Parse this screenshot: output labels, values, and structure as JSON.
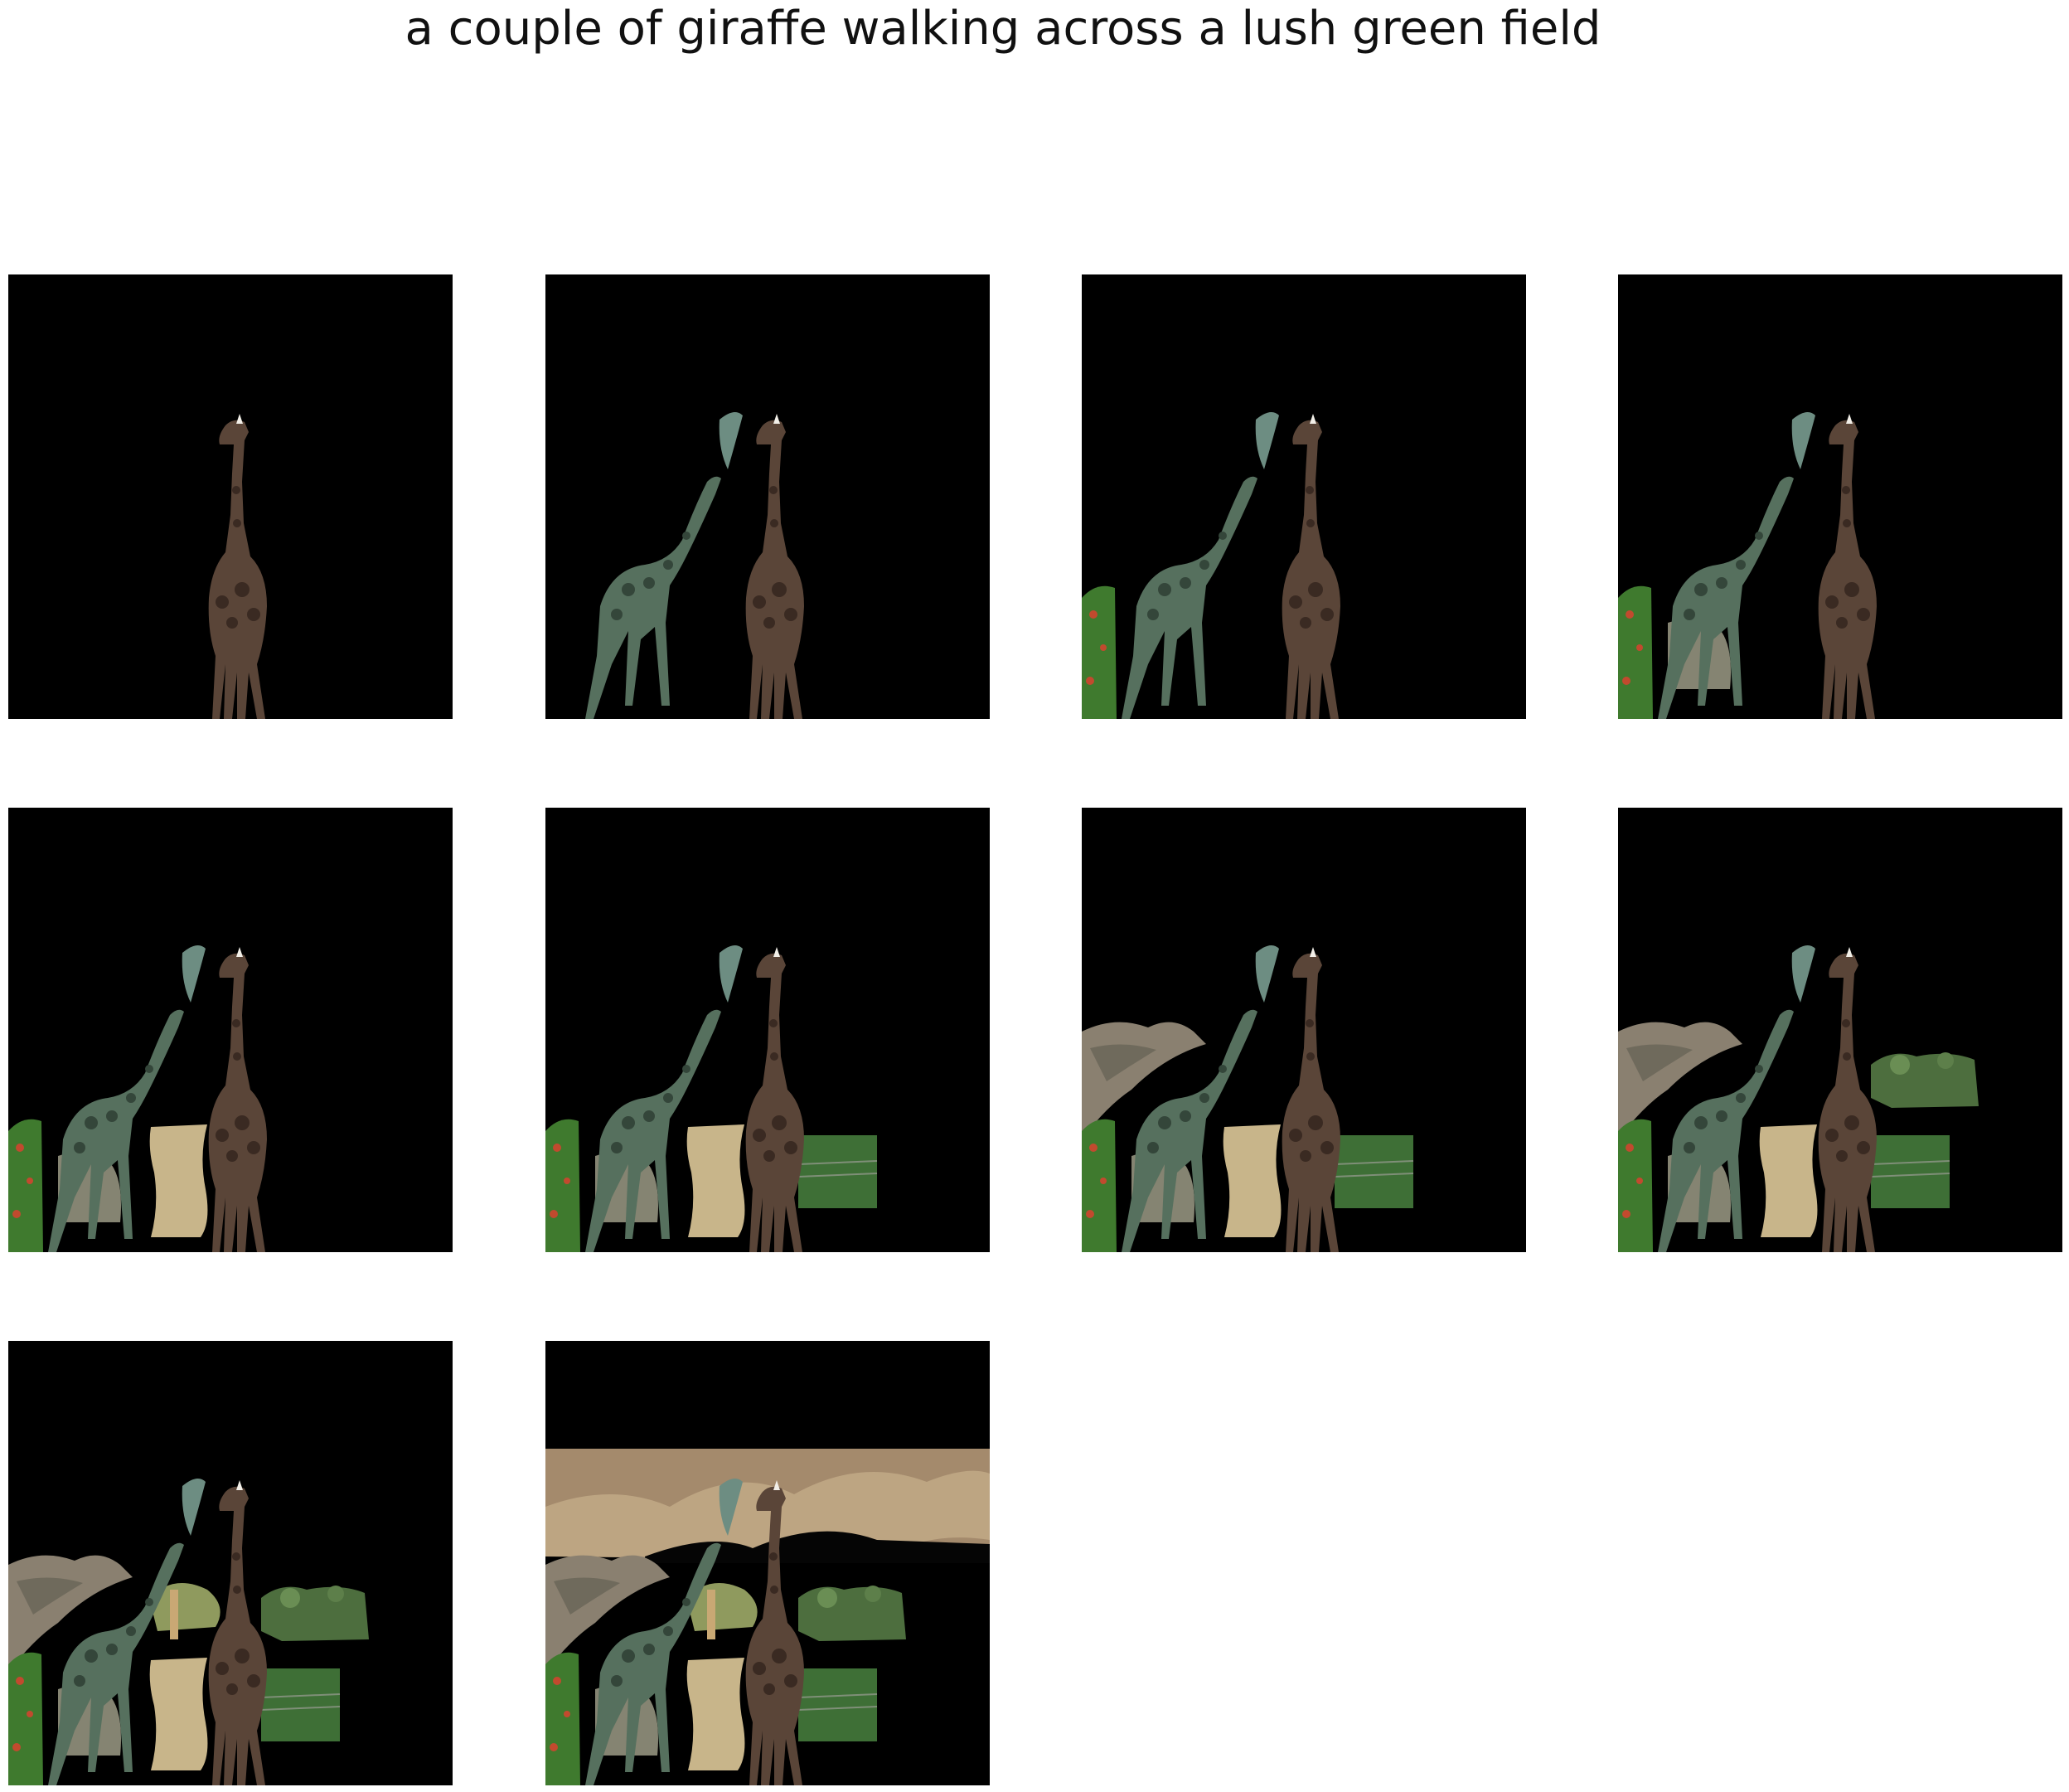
{
  "caption": "a couple of giraffe walking across a lush green field",
  "panels": [
    {
      "step": 1,
      "layers": [
        "giraffe-a"
      ]
    },
    {
      "step": 2,
      "layers": [
        "giraffe-a",
        "giraffe-b",
        "head-patch"
      ]
    },
    {
      "step": 3,
      "layers": [
        "giraffe-a",
        "giraffe-b",
        "head-patch",
        "bush-left"
      ]
    },
    {
      "step": 4,
      "layers": [
        "giraffe-a",
        "giraffe-b",
        "head-patch",
        "bush-left",
        "ground-patch"
      ]
    },
    {
      "step": 5,
      "layers": [
        "giraffe-a",
        "giraffe-b",
        "head-patch",
        "bush-left",
        "ground-patch",
        "sand-patch"
      ]
    },
    {
      "step": 6,
      "layers": [
        "giraffe-a",
        "giraffe-b",
        "head-patch",
        "bush-left",
        "ground-patch",
        "sand-patch",
        "grass-patch"
      ]
    },
    {
      "step": 7,
      "layers": [
        "giraffe-a",
        "giraffe-b",
        "head-patch",
        "bush-left",
        "ground-patch",
        "sand-patch",
        "grass-patch",
        "rocks-left"
      ]
    },
    {
      "step": 8,
      "layers": [
        "giraffe-a",
        "giraffe-b",
        "head-patch",
        "bush-left",
        "ground-patch",
        "sand-patch",
        "grass-patch",
        "rocks-left",
        "trees-right"
      ]
    },
    {
      "step": 9,
      "layers": [
        "giraffe-a",
        "giraffe-b",
        "head-patch",
        "bush-left",
        "ground-patch",
        "sand-patch",
        "grass-patch",
        "rocks-left",
        "trees-right",
        "shrub-center"
      ]
    },
    {
      "step": 10,
      "layers": [
        "giraffe-a",
        "giraffe-b",
        "head-patch",
        "bush-left",
        "ground-patch",
        "sand-patch",
        "grass-patch",
        "rocks-left",
        "trees-right",
        "shrub-center",
        "sky"
      ]
    }
  ],
  "colors": {
    "background": "#ffffff",
    "panel": "#000000",
    "giraffe_a": "#5a4538",
    "giraffe_a_spots": "#3a2a22",
    "giraffe_b": "#56705e",
    "giraffe_b_spots": "#34463a",
    "bush": "#3f7a2e",
    "sand": "#c8b58a",
    "grass": "#3e6f36",
    "rocks": "#8a8070",
    "trees": "#4d6e3e",
    "sky": "#a48a6c",
    "ground": "#9c9b86"
  }
}
